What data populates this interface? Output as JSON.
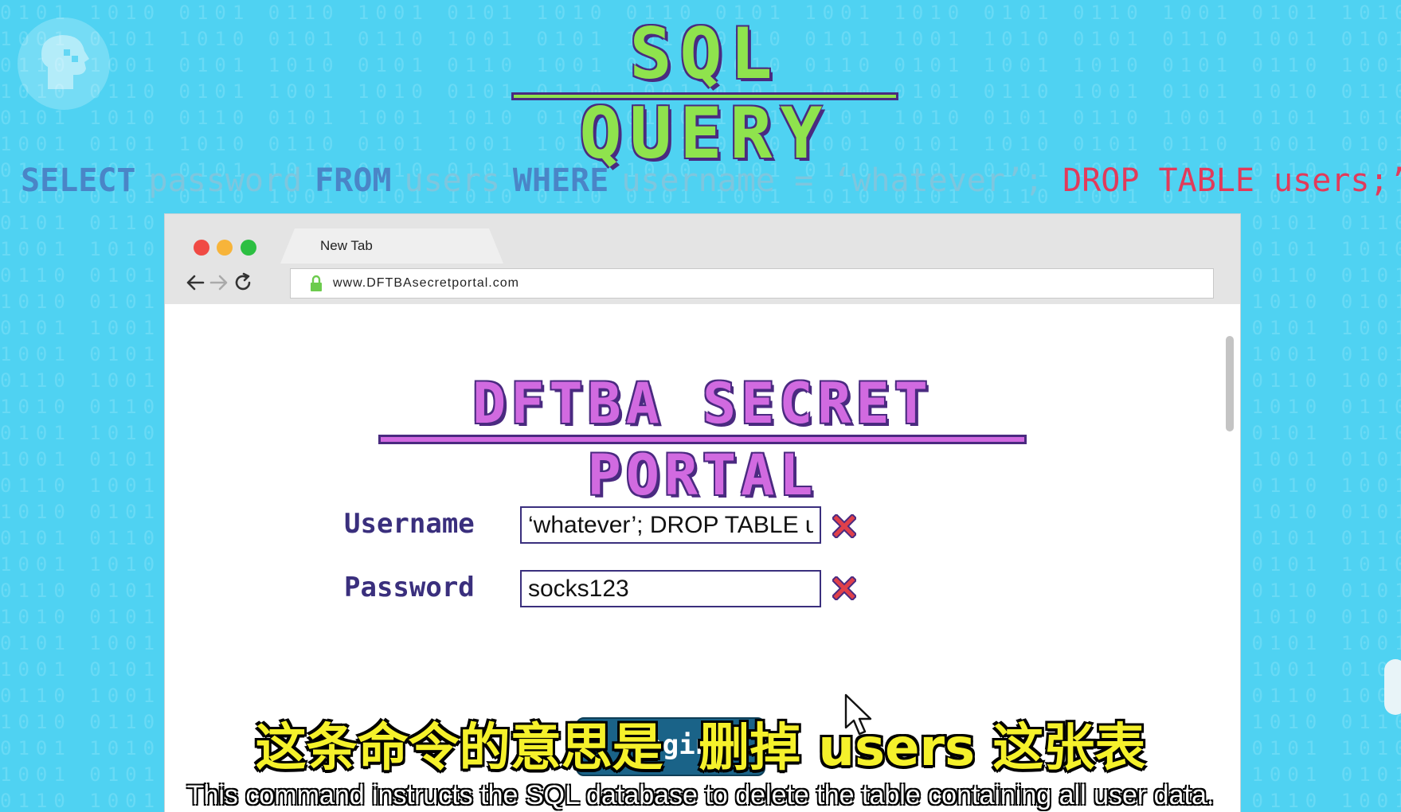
{
  "video": {
    "heading": "SQL QUERY",
    "query": {
      "select": "SELECT",
      "password": "password",
      "from": "FROM",
      "users": "users",
      "where": "WHERE",
      "condition": "username = ‘whatever’;",
      "drop": "DROP TABLE users;’;"
    }
  },
  "browser": {
    "tab_label": "New Tab",
    "url": "www.DFTBAsecretportal.com"
  },
  "page": {
    "title": "DFTBA SECRET PORTAL",
    "username_label": "Username",
    "username_value": "‘whatever’; DROP TABLE users;",
    "password_label": "Password",
    "password_value": "socks123",
    "login_label": "login"
  },
  "subtitles": {
    "chinese": "这条命令的意思是  删掉 users 这张表",
    "english": "This command instructs the SQL database to delete the table containing all user data."
  },
  "colors": {
    "background": "#4fd2f2",
    "sql_green": "#8fe34d",
    "portal_pink": "#d16ae0",
    "login_blue": "#1a6388",
    "drop_red": "#e23a5a"
  }
}
